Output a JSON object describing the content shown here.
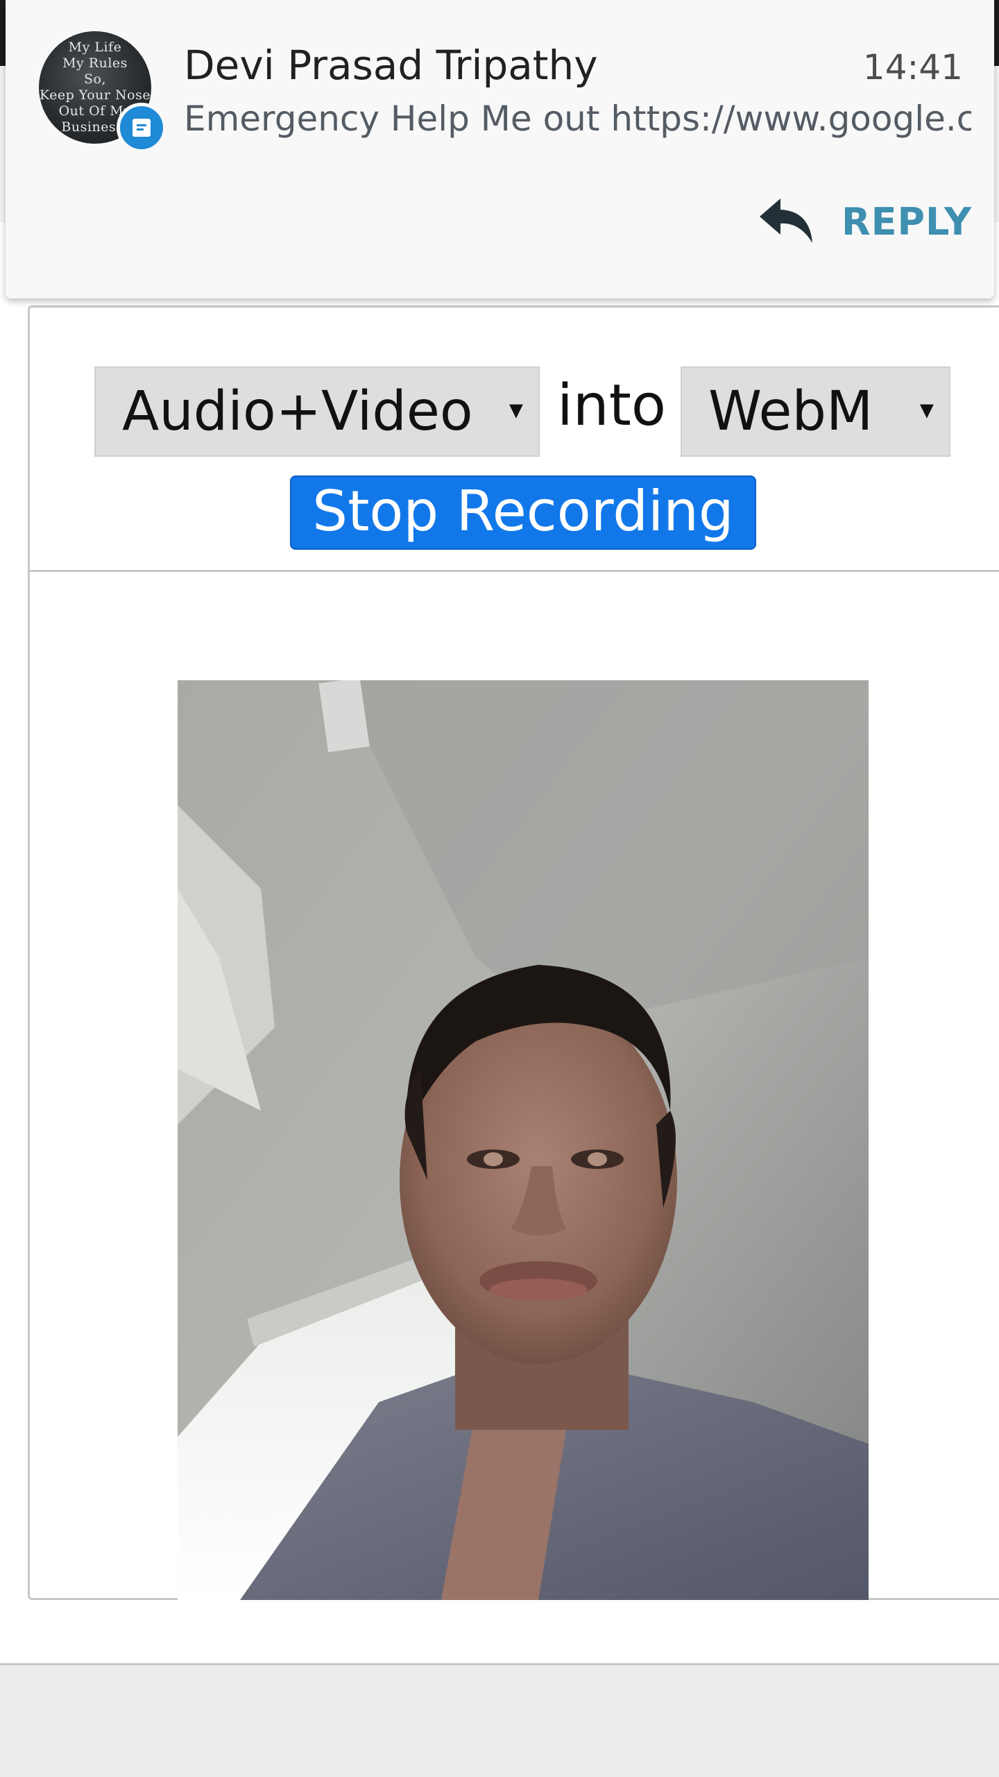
{
  "notification": {
    "sender": "Devi Prasad Tripathy",
    "time": "14:41",
    "message": "Emergency Help Me out https://www.google.co..",
    "avatar_lines": [
      "My Life",
      "My Rules",
      "So,",
      "Keep Your Nose",
      "Out Of My",
      "Business!"
    ],
    "reply_label": "REPLY",
    "reply_color": "#3e8fb0",
    "badge_color": "#1f8ad6",
    "reply_icon": "reply-arrow-icon",
    "badge_icon": "message-icon"
  },
  "recorder": {
    "media_select": "Audio+Video",
    "into_label": "into",
    "format_select": "WebM",
    "dropdown_arrow": "▾",
    "stop_button": "Stop Recording",
    "button_color": "#1278ea"
  }
}
